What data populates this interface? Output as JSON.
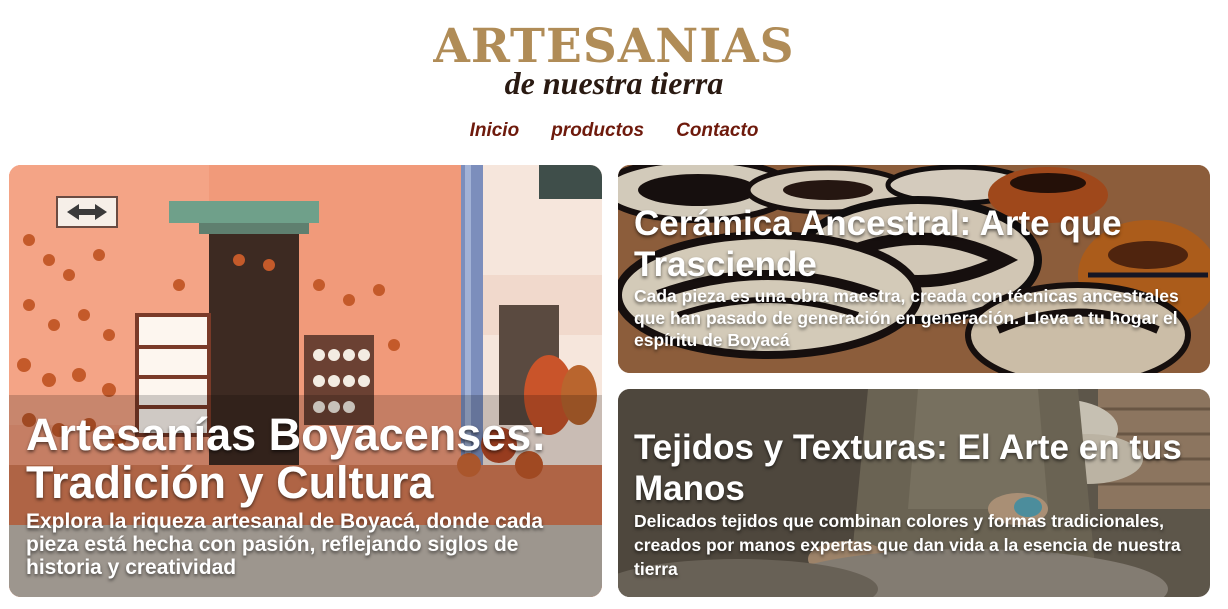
{
  "brand": {
    "title": "ARTESANIAS",
    "subtitle": "de nuestra tierra"
  },
  "nav": {
    "items": [
      {
        "label": "Inicio"
      },
      {
        "label": "productos"
      },
      {
        "label": "Contacto"
      }
    ]
  },
  "cards": {
    "main": {
      "title": "Artesanías Boyacenses: Tradición y Cultura",
      "text": "Explora la riqueza artesanal de Boyacá, donde cada pieza está hecha con pasión, reflejando siglos de historia y creatividad"
    },
    "ceramica": {
      "title": "Cerámica Ancestral: Arte que Trasciende",
      "text": "Cada pieza es una obra maestra, creada con técnicas ancestrales que han pasado de generación en generación. Lleva a tu hogar el espíritu de Boyacá"
    },
    "tejidos": {
      "title": "Tejidos y Texturas: El Arte en tus Manos",
      "text": "Delicados tejidos que combinan colores y formas tradicionales, creados por manos expertas que dan vida a la esencia de nuestra tierra"
    }
  },
  "colors": {
    "brand_gold": "#b08c57",
    "brand_dark": "#2a1a12",
    "nav_link": "#6e1a0c"
  }
}
